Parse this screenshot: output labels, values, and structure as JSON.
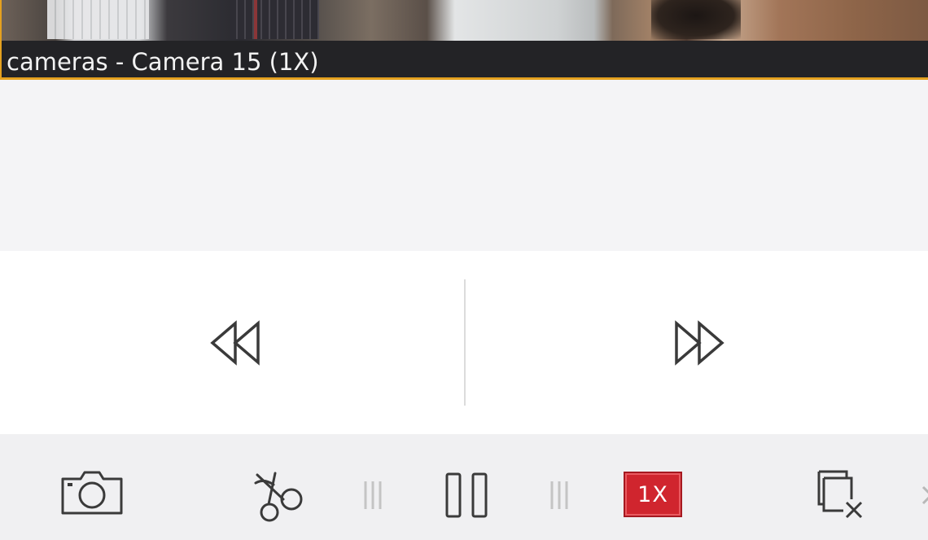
{
  "video": {
    "caption": "cameras - Camera 15 (1X)"
  },
  "controls": {
    "seek": {
      "rewind_icon": "rewind-icon",
      "fast_forward_icon": "fast-forward-icon"
    },
    "toolbar": {
      "snapshot_icon": "camera-icon",
      "clip_icon": "scissors-icon",
      "pause_icon": "pause-icon",
      "speed_label": "1X",
      "close_window_icon": "close-window-icon",
      "more_icon": "chevron-right-icon"
    }
  },
  "colors": {
    "accent_border": "#e5a11f",
    "speed_badge": "#d0252e",
    "icon_stroke": "#3a3a3a",
    "grip": "#c4c4c4"
  }
}
